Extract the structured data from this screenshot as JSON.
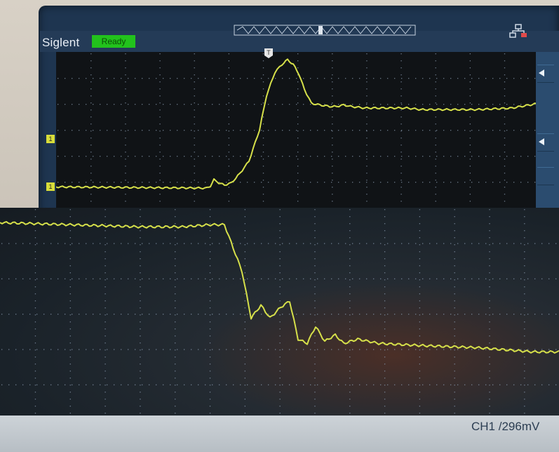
{
  "scope": {
    "brand": "Siglent",
    "status": "Ready",
    "trigger_marker_label": "T",
    "channel_marker_label": "1",
    "readout": "CH1 /296mV"
  },
  "colors": {
    "trace": "#d6e04a",
    "grid": "#8a9bb0",
    "status_bg": "#22c21c",
    "bezel": "#1e3550"
  },
  "icons": [
    "network-icon",
    "trigger-marker-icon",
    "channel-marker-icon",
    "side-arrow-icon",
    "timebase-window-icon"
  ],
  "traces": {
    "top": {
      "description_points_x": [
        0,
        215,
        220,
        225,
        232,
        240,
        250,
        262,
        275,
        290,
        300,
        312,
        322,
        330,
        338,
        346,
        354,
        364,
        376,
        390,
        400,
        410,
        420,
        440,
        470,
        500,
        520,
        560,
        600,
        650,
        688
      ],
      "description_points_y": [
        0.866,
        0.874,
        0.86,
        0.82,
        0.84,
        0.855,
        0.84,
        0.78,
        0.7,
        0.5,
        0.28,
        0.13,
        0.08,
        0.05,
        0.08,
        0.14,
        0.24,
        0.33,
        0.34,
        0.35,
        0.35,
        0.34,
        0.35,
        0.36,
        0.36,
        0.36,
        0.37,
        0.37,
        0.37,
        0.36,
        0.33
      ]
    },
    "bottom": {
      "description_points_x": [
        0,
        100,
        200,
        260,
        300,
        320,
        345,
        358,
        372,
        385,
        400,
        413,
        425,
        438,
        450,
        463,
        478,
        490,
        510,
        540,
        600,
        680,
        760,
        797
      ],
      "description_points_y": [
        0.07,
        0.08,
        0.09,
        0.09,
        0.08,
        0.08,
        0.3,
        0.52,
        0.46,
        0.52,
        0.47,
        0.44,
        0.62,
        0.64,
        0.56,
        0.63,
        0.6,
        0.64,
        0.62,
        0.64,
        0.65,
        0.66,
        0.68,
        0.68
      ]
    }
  }
}
